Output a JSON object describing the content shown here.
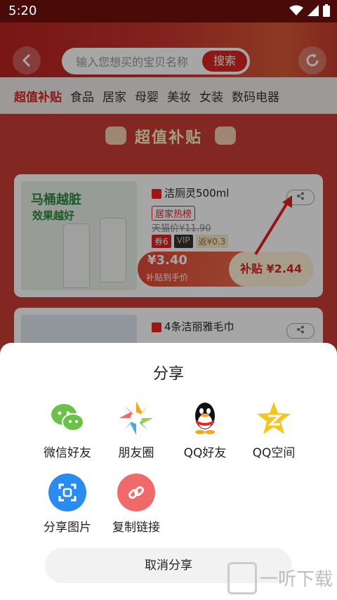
{
  "status_bar": {
    "time": "5:20"
  },
  "header": {
    "search_placeholder": "输入您想买的宝贝名称",
    "search_button": "搜索"
  },
  "tabs": [
    "超值补贴",
    "食品",
    "居家",
    "母婴",
    "美妆",
    "女装",
    "数码电器"
  ],
  "banner": {
    "title": "超值补贴"
  },
  "products": [
    {
      "name": "洁厕灵500ml",
      "image_text_1": "马桶越脏",
      "image_text_2": "效果越好",
      "tag": "居家热榜",
      "original_price": "天猫价¥11.90",
      "badge_coupon": "券6",
      "badge_vip": "VIP",
      "badge_rebate": "返¥0.3",
      "price": "¥3.40",
      "price_note": "补贴到手价",
      "subsidy": "补贴 ¥2.44"
    },
    {
      "name": "4条洁丽雅毛巾"
    }
  ],
  "share_sheet": {
    "title": "分享",
    "items": [
      {
        "label": "微信好友",
        "icon": "wechat-icon",
        "color": "#6cc14a"
      },
      {
        "label": "朋友圈",
        "icon": "moments-icon",
        "color": "#f5a623"
      },
      {
        "label": "QQ好友",
        "icon": "qq-icon",
        "color": "#111111"
      },
      {
        "label": "QQ空间",
        "icon": "qzone-icon",
        "color": "#f7c51e"
      },
      {
        "label": "分享图片",
        "icon": "share-image-icon",
        "color": "#2a8cf0"
      },
      {
        "label": "复制链接",
        "icon": "copy-link-icon",
        "color": "#f06a6a"
      }
    ],
    "cancel": "取消分享"
  },
  "watermark": "一听下载"
}
